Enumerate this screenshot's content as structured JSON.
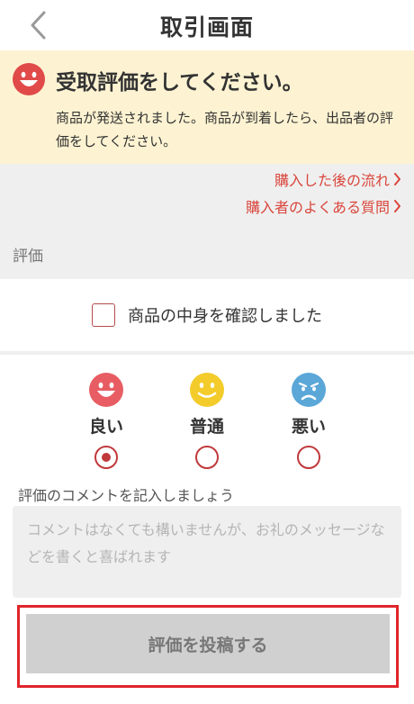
{
  "header": {
    "title": "取引画面"
  },
  "notice": {
    "title": "受取評価をしてください。",
    "body": "商品が発送されました。商品が到着したら、出品者の評価をしてください。"
  },
  "links": [
    {
      "label": "購入した後の流れ"
    },
    {
      "label": "購入者のよくある質問"
    }
  ],
  "section": {
    "label": "評価"
  },
  "confirm": {
    "label": "商品の中身を確認しました",
    "checked": false
  },
  "rating": {
    "options": [
      {
        "label": "良い",
        "face": "smile",
        "color": "#e85d63",
        "selected": true
      },
      {
        "label": "普通",
        "face": "neutral",
        "color": "#f3cc2b",
        "selected": false
      },
      {
        "label": "悪い",
        "face": "sad",
        "color": "#5aa7d8",
        "selected": false
      }
    ]
  },
  "comment": {
    "label": "評価のコメントを記入しましょう",
    "placeholder": "コメントはなくても構いませんが、お礼のメッセージなどを書くと喜ばれます",
    "value": ""
  },
  "submit": {
    "label": "評価を投稿する"
  },
  "colors": {
    "accent": "#d9463c",
    "notice_bg": "#fdf3d2",
    "highlight_border": "#e0242b"
  }
}
